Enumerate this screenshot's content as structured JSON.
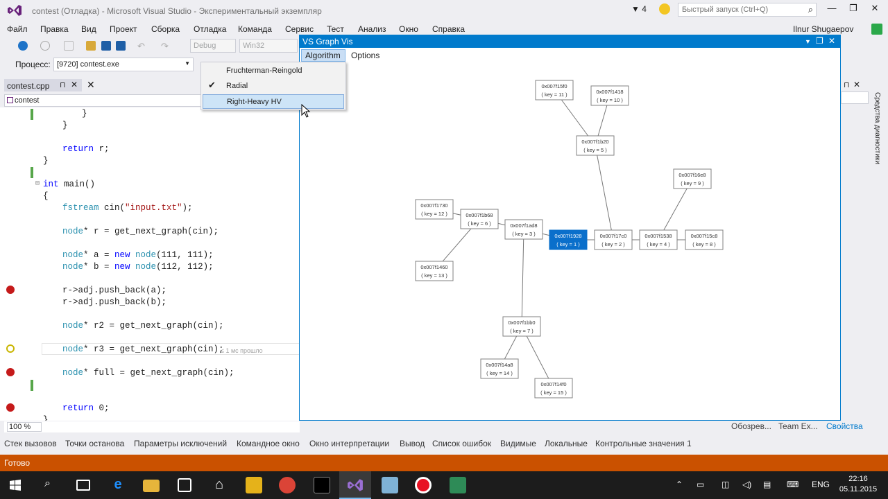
{
  "titlebar": {
    "title": "contest (Отладка) - Microsoft Visual Studio - Экспериментальный экземпляр",
    "notif_count": "4",
    "quick_launch_placeholder": "Быстрый запуск (Ctrl+Q)"
  },
  "menu": {
    "items": [
      "Файл",
      "Правка",
      "Вид",
      "Проект",
      "Сборка",
      "Отладка",
      "Команда",
      "Сервис",
      "Тест",
      "Анализ",
      "Окно",
      "Справка"
    ],
    "user": "Ilnur Shugaepov"
  },
  "toolbar": {
    "config": "Debug",
    "platform": "Win32"
  },
  "process": {
    "label": "Процесс:",
    "value": "[9720] contest.exe"
  },
  "document": {
    "tab": "contest.cpp",
    "scope": "contest",
    "zoom": "100 %"
  },
  "code": {
    "l1": "}",
    "l2": "}",
    "l3_kw": "return",
    "l3_rest": " r;",
    "l4": "}",
    "l5_kw": "int",
    "l5_rest": " main()",
    "l6": "{",
    "l7_ty": "fstream",
    "l7_mid": " cin(",
    "l7_str": "\"input.txt\"",
    "l7_end": ");",
    "l8_ty": "node",
    "l8_rest": "* r = get_next_graph(cin);",
    "l9_ty": "node",
    "l9_mid": "* a = ",
    "l9_kw": "new",
    "l9_ty2": " node",
    "l9_end": "(111, 111);",
    "l10_ty": "node",
    "l10_mid": "* b = ",
    "l10_kw": "new",
    "l10_ty2": " node",
    "l10_end": "(112, 112);",
    "l11": "r->adj.push_back(a);",
    "l12": "r->adj.push_back(b);",
    "l13_ty": "node",
    "l13_rest": "* r2 = get_next_graph(cin);",
    "l14_ty": "node",
    "l14_rest": "* r3 = get_next_graph(cin);",
    "l14_hint": "≤ 1 мс прошло",
    "l15_ty": "node",
    "l15_rest": "* full = get_next_graph(cin);",
    "l16_kw": "return",
    "l16_rest": " 0;",
    "l17": "}"
  },
  "graph_window": {
    "title": "VS Graph Vis",
    "menu_algorithm": "Algorithm",
    "menu_options": "Options",
    "algorithms": [
      {
        "label": "Fruchterman-Reingold",
        "checked": false,
        "highlighted": false
      },
      {
        "label": "Radial",
        "checked": true,
        "highlighted": false
      },
      {
        "label": "Right-Heavy HV",
        "checked": false,
        "highlighted": true
      }
    ],
    "nodes": [
      {
        "id": "n11",
        "addr": "0x007f15f0",
        "key": "( key = 11 )"
      },
      {
        "id": "n10",
        "addr": "0x007f1418",
        "key": "( key = 10 )"
      },
      {
        "id": "n5",
        "addr": "0x007f1b20",
        "key": "( key = 5 )"
      },
      {
        "id": "n9",
        "addr": "0x007f16e8",
        "key": "( key = 9 )"
      },
      {
        "id": "n12",
        "addr": "0x007f1730",
        "key": "( key = 12 )"
      },
      {
        "id": "n6",
        "addr": "0x007f1b68",
        "key": "( key = 6 )"
      },
      {
        "id": "n3",
        "addr": "0x007f1ad8",
        "key": "( key = 3 )"
      },
      {
        "id": "n1",
        "addr": "0x007f1928",
        "key": "( key = 1 )",
        "selected": true
      },
      {
        "id": "n2",
        "addr": "0x007f17c0",
        "key": "( key = 2 )"
      },
      {
        "id": "n4",
        "addr": "0x007f1538",
        "key": "( key = 4 )"
      },
      {
        "id": "n8",
        "addr": "0x007f15c8",
        "key": "( key = 8 )"
      },
      {
        "id": "n13",
        "addr": "0x007f1460",
        "key": "( key = 13 )"
      },
      {
        "id": "n7",
        "addr": "0x007f1bb0",
        "key": "( key = 7 )"
      },
      {
        "id": "n14",
        "addr": "0x007f14a8",
        "key": "( key = 14 )"
      },
      {
        "id": "n15",
        "addr": "0x007f14f0",
        "key": "( key = 15 )"
      }
    ],
    "edges": [
      [
        "n11",
        "n5"
      ],
      [
        "n10",
        "n5"
      ],
      [
        "n5",
        "n2"
      ],
      [
        "n9",
        "n4"
      ],
      [
        "n12",
        "n6"
      ],
      [
        "n6",
        "n3"
      ],
      [
        "n6",
        "n13"
      ],
      [
        "n3",
        "n1"
      ],
      [
        "n1",
        "n2"
      ],
      [
        "n2",
        "n4"
      ],
      [
        "n4",
        "n8"
      ],
      [
        "n3",
        "n7"
      ],
      [
        "n7",
        "n14"
      ],
      [
        "n7",
        "n15"
      ]
    ]
  },
  "side": {
    "diagnostics_tab": "Средства диагностики"
  },
  "right_tabs": [
    "Обозрев...",
    "Team Ex...",
    "Свойства"
  ],
  "bottom_tabs": [
    "Стек вызовов",
    "Точки останова",
    "Параметры исключений",
    "Командное окно",
    "Окно интерпретации",
    "Вывод",
    "Список ошибок",
    "Видимые",
    "Локальные",
    "Контрольные значения 1"
  ],
  "status": {
    "text": "Готово",
    "color": "#ca5100"
  },
  "taskbar": {
    "lang": "ENG",
    "time": "22:16",
    "date": "05.11.2015"
  },
  "colors": {
    "accent": "#007acc",
    "selected_node": "#0a6fcb"
  }
}
